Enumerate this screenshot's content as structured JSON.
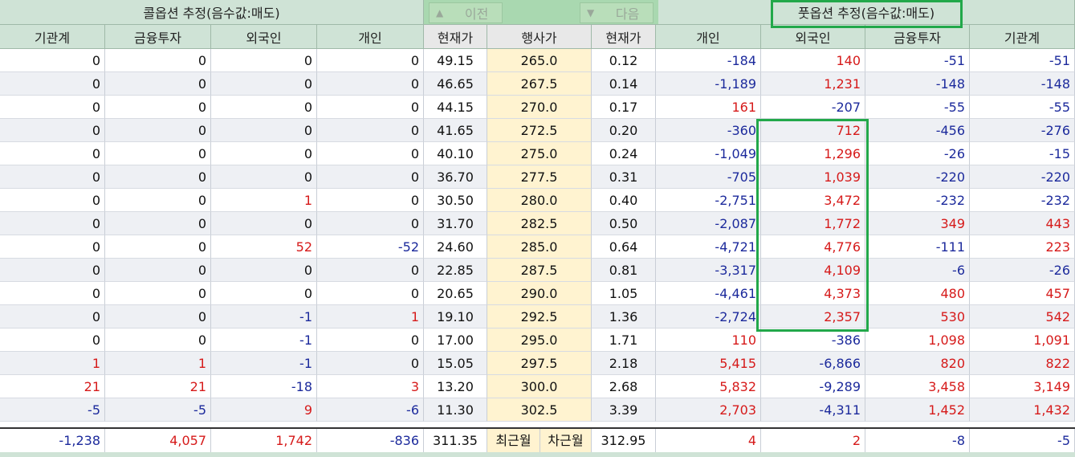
{
  "call_title": "콜옵션 추정(음수값:매도)",
  "put_title": "풋옵션 추정(음수값:매도)",
  "nav": {
    "prev_label": "이전",
    "next_label": "다음"
  },
  "headers": [
    "기관계",
    "금융투자",
    "외국인",
    "개인",
    "현재가",
    "행사가",
    "현재가",
    "개인",
    "외국인",
    "금융투자",
    "기관계"
  ],
  "rows": [
    [
      "0",
      "0",
      "0",
      "0",
      "49.15",
      "265.0",
      "0.12",
      "-184",
      "140",
      "-51",
      "-51"
    ],
    [
      "0",
      "0",
      "0",
      "0",
      "46.65",
      "267.5",
      "0.14",
      "-1,189",
      "1,231",
      "-148",
      "-148"
    ],
    [
      "0",
      "0",
      "0",
      "0",
      "44.15",
      "270.0",
      "0.17",
      "161",
      "-207",
      "-55",
      "-55"
    ],
    [
      "0",
      "0",
      "0",
      "0",
      "41.65",
      "272.5",
      "0.20",
      "-360",
      "712",
      "-456",
      "-276"
    ],
    [
      "0",
      "0",
      "0",
      "0",
      "40.10",
      "275.0",
      "0.24",
      "-1,049",
      "1,296",
      "-26",
      "-15"
    ],
    [
      "0",
      "0",
      "0",
      "0",
      "36.70",
      "277.5",
      "0.31",
      "-705",
      "1,039",
      "-220",
      "-220"
    ],
    [
      "0",
      "0",
      "1",
      "0",
      "30.50",
      "280.0",
      "0.40",
      "-2,751",
      "3,472",
      "-232",
      "-232"
    ],
    [
      "0",
      "0",
      "0",
      "0",
      "31.70",
      "282.5",
      "0.50",
      "-2,087",
      "1,772",
      "349",
      "443"
    ],
    [
      "0",
      "0",
      "52",
      "-52",
      "24.60",
      "285.0",
      "0.64",
      "-4,721",
      "4,776",
      "-111",
      "223"
    ],
    [
      "0",
      "0",
      "0",
      "0",
      "22.85",
      "287.5",
      "0.81",
      "-3,317",
      "4,109",
      "-6",
      "-26"
    ],
    [
      "0",
      "0",
      "0",
      "0",
      "20.65",
      "290.0",
      "1.05",
      "-4,461",
      "4,373",
      "480",
      "457"
    ],
    [
      "0",
      "0",
      "-1",
      "1",
      "19.10",
      "292.5",
      "1.36",
      "-2,724",
      "2,357",
      "530",
      "542"
    ],
    [
      "0",
      "0",
      "-1",
      "0",
      "17.00",
      "295.0",
      "1.71",
      "110",
      "-386",
      "1,098",
      "1,091"
    ],
    [
      "1",
      "1",
      "-1",
      "0",
      "15.05",
      "297.5",
      "2.18",
      "5,415",
      "-6,866",
      "820",
      "822"
    ],
    [
      "21",
      "21",
      "-18",
      "3",
      "13.20",
      "300.0",
      "2.68",
      "5,832",
      "-9,289",
      "3,458",
      "3,149"
    ],
    [
      "-5",
      "-5",
      "9",
      "-6",
      "11.30",
      "302.5",
      "3.39",
      "2,703",
      "-4,311",
      "1,452",
      "1,432"
    ]
  ],
  "footer": {
    "call_institution": "-1,238",
    "call_finance": "4,057",
    "call_foreign": "1,742",
    "call_individual": "-836",
    "call_price": "311.35",
    "near_month": "최근월",
    "next_month": "차근월",
    "put_price": "312.95",
    "put_individual": "4",
    "put_foreign": "2",
    "put_finance": "-8",
    "put_institution": "-5"
  },
  "colors": {
    "positive": "#d61a1a",
    "negative": "#1c2a9c",
    "highlight": "#22a84a",
    "header_bg": "#cfe3d6",
    "strike_bg": "#fff3d0"
  }
}
